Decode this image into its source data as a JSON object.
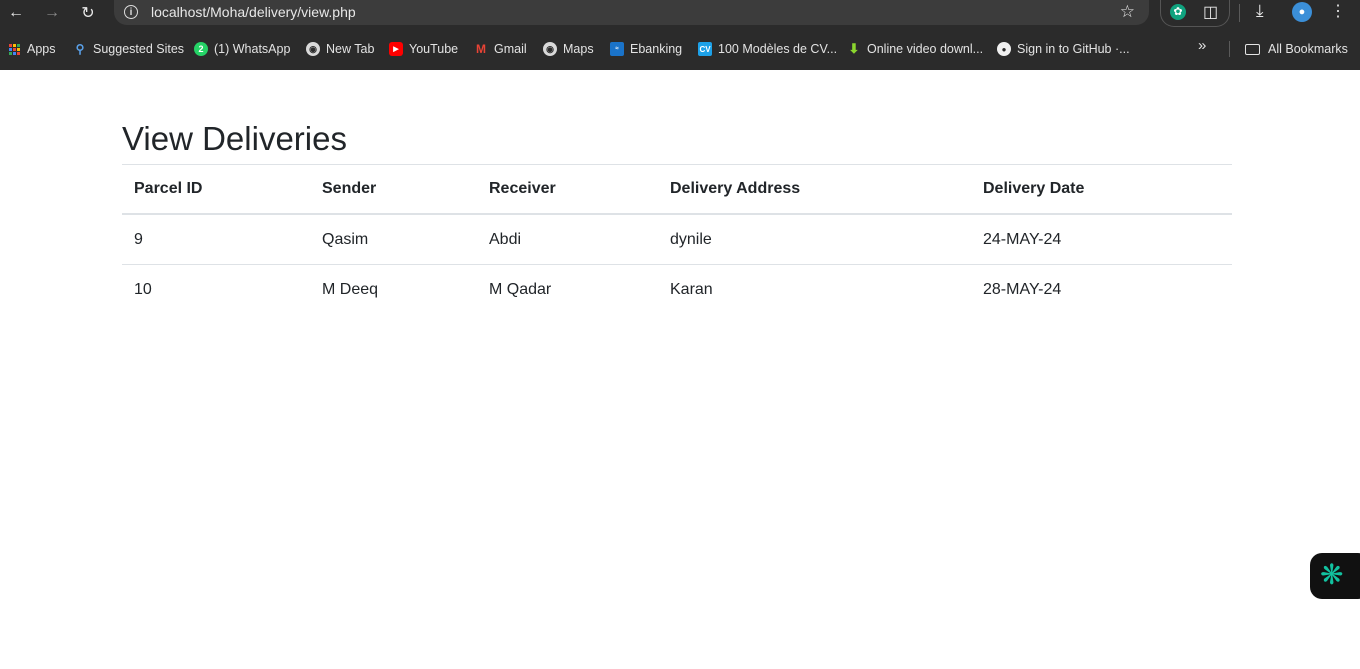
{
  "browser": {
    "url": "localhost/Moha/delivery/view.php",
    "bookmarks": [
      {
        "label": "Apps",
        "icon": "apps-grid-icon"
      },
      {
        "label": "Suggested Sites",
        "icon": "search-icon"
      },
      {
        "label": "(1) WhatsApp",
        "icon": "whatsapp-icon"
      },
      {
        "label": "New Tab",
        "icon": "globe-icon"
      },
      {
        "label": "YouTube",
        "icon": "youtube-icon"
      },
      {
        "label": "Gmail",
        "icon": "gmail-icon"
      },
      {
        "label": "Maps",
        "icon": "globe-icon"
      },
      {
        "label": "Ebanking",
        "icon": "ebanking-icon"
      },
      {
        "label": "100 Modèles de CV...",
        "icon": "cv-icon"
      },
      {
        "label": "Online video downl...",
        "icon": "download-arrow-icon"
      },
      {
        "label": "Sign in to GitHub ·...",
        "icon": "github-icon"
      }
    ],
    "all_bookmarks": "All Bookmarks"
  },
  "page": {
    "title": "View Deliveries",
    "table": {
      "headers": [
        "Parcel ID",
        "Sender",
        "Receiver",
        "Delivery Address",
        "Delivery Date"
      ],
      "rows": [
        [
          "9",
          "Qasim",
          "Abdi",
          "dynile",
          "24-MAY-24"
        ],
        [
          "10",
          "M Deeq",
          "M Qadar",
          "Karan",
          "28-MAY-24"
        ]
      ]
    }
  },
  "colors": {
    "chrome_bg": "#2b2b2b",
    "omnibox_bg": "#3c3c3c",
    "text_dark": "#212529",
    "table_border": "#dee2e6",
    "widget_accent": "#12c2a0"
  }
}
